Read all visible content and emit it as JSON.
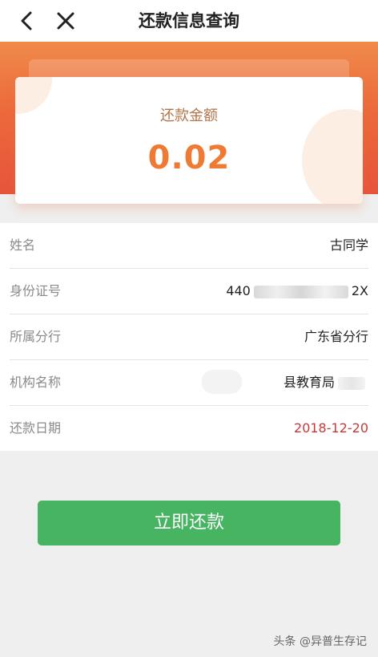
{
  "nav": {
    "title": "还款信息查询",
    "back_icon": "chevron-left-icon",
    "close_icon": "close-icon"
  },
  "colors": {
    "band_orange": "#ec6a3b",
    "amount_orange": "#ee7a34",
    "button_green": "#47b462",
    "date_red": "#c6393b"
  },
  "card": {
    "label": "还款金额",
    "amount": "0.02"
  },
  "info": {
    "name_label": "姓名",
    "name_value": "古同学",
    "id_label": "身份证号",
    "id_prefix": "440",
    "id_suffix": "2X",
    "branch_label": "所属分行",
    "branch_value": "广东省分行",
    "org_label": "机构名称",
    "org_value": "县教育局",
    "date_label": "还款日期",
    "date_value": "2018-12-20"
  },
  "button": {
    "label": "立即还款"
  },
  "watermark": {
    "text": "头条 @异普生存记"
  }
}
